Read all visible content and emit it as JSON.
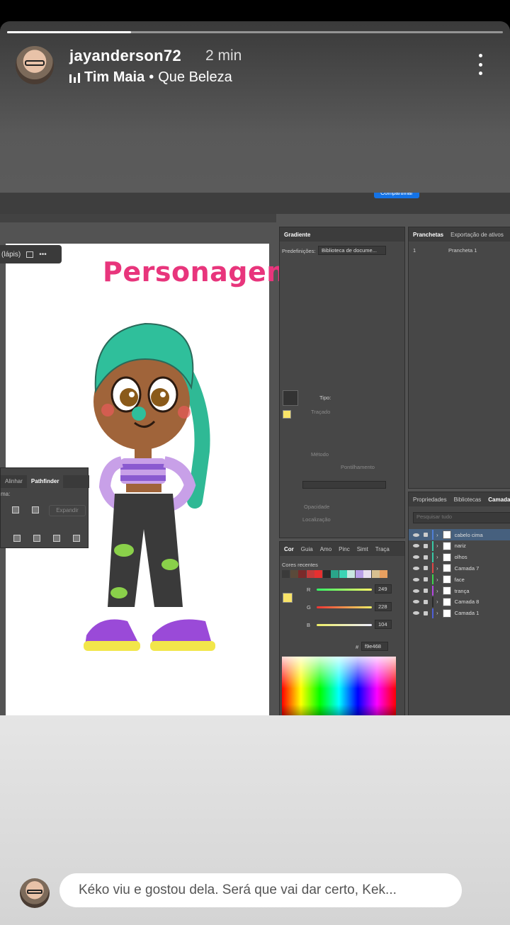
{
  "story": {
    "progress": 0.25,
    "username": "jayanderson72",
    "time": "2 min",
    "music_song": "Tim Maia",
    "music_separator": "•",
    "music_track": "Que Beleza"
  },
  "app": {
    "share_label": "Compartilhar",
    "tool_label": "(lápis)",
    "headline": "Personagem nova?",
    "pathfinder": {
      "tabs": [
        "Alinhar",
        "Pathfinder"
      ],
      "shape_label": "ma:",
      "expand_label": "Expandir"
    },
    "gradient_panel": {
      "title": "Gradiente",
      "presets_label": "Predefinições:",
      "presets_value": "Biblioteca de docume...",
      "type_label": "Tipo:",
      "stroke_label": "Traçado",
      "method_label": "Método",
      "dither_label": "Pontilhamento",
      "opacity_label": "Opacidade",
      "location_label": "Localização"
    },
    "artboards_panel": {
      "tabs": [
        "Pranchetas",
        "Exportação de ativos"
      ],
      "row_number": "1",
      "row_name": "Prancheta 1"
    },
    "layers_panel": {
      "tabs": [
        "Propriedades",
        "Bibliotecas",
        "Camada"
      ],
      "search_placeholder": "Pesquisar tudo",
      "layers": [
        {
          "name": "cabelo cima",
          "color": "#4f7fd6",
          "selected": true
        },
        {
          "name": "nariz",
          "color": "#38c9a6",
          "selected": false
        },
        {
          "name": "olhos",
          "color": "#38c9a6",
          "selected": false
        },
        {
          "name": "Camada 7",
          "color": "#e04747",
          "selected": false
        },
        {
          "name": "face",
          "color": "#3cd44f",
          "selected": false
        },
        {
          "name": "trança",
          "color": "#b347e0",
          "selected": false
        },
        {
          "name": "Camada 8",
          "color": "#2b2b2b",
          "selected": false
        },
        {
          "name": "Camada 1",
          "color": "#4f5fd6",
          "selected": false
        }
      ]
    },
    "color_panel": {
      "tabs": [
        "Cor",
        "Guia",
        "Amo",
        "Pinc",
        "Simt",
        "Traça"
      ],
      "recent_label": "Cores recentes",
      "r_label": "R",
      "g_label": "G",
      "b_label": "B",
      "r_value": "249",
      "g_value": "228",
      "b_value": "104",
      "hex_symbol": "#",
      "hex_value": "f9e468",
      "current_color": "#f9e468",
      "recent_colors": [
        "#3a3a3a",
        "#5a4a3a",
        "#7a2a2a",
        "#c23a3a",
        "#e63030",
        "#2a2a2a",
        "#2aa58a",
        "#3cd4b4",
        "#c8e8e0",
        "#b8a0e8",
        "#e8e0f0",
        "#d8c090",
        "#e8a060"
      ]
    }
  },
  "reply": {
    "placeholder": "Kéko viu e gostou dela. Será que vai dar certo, Kek..."
  }
}
